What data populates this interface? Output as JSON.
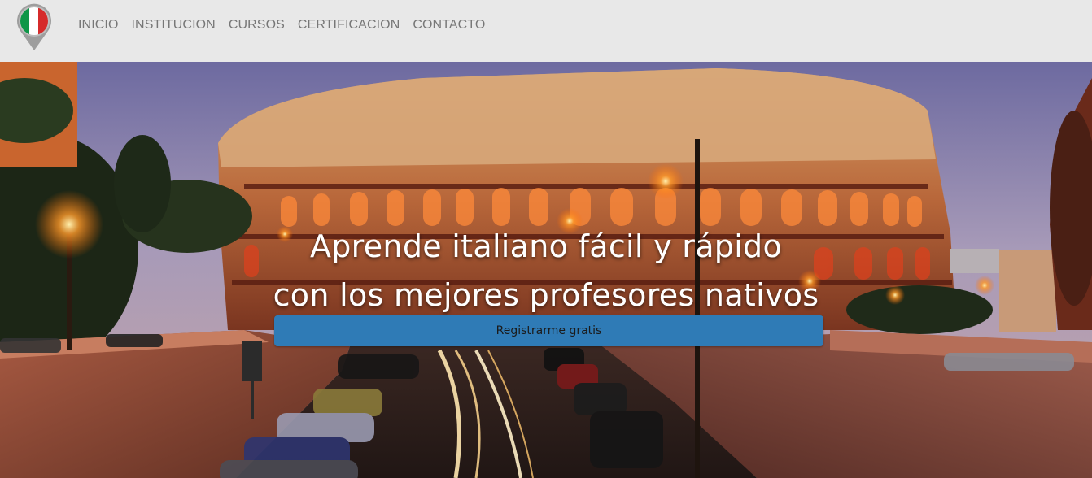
{
  "nav": {
    "items": [
      {
        "label": "INICIO"
      },
      {
        "label": "INSTITUCION"
      },
      {
        "label": "CURSOS"
      },
      {
        "label": "CERTIFICACION"
      },
      {
        "label": "CONTACTO"
      }
    ]
  },
  "logo": {
    "icon": "italy-flag-pin-icon",
    "colors": {
      "green": "#0f9648",
      "white": "#ffffff",
      "red": "#d62b2b",
      "pin": "#9e9e9e"
    }
  },
  "hero": {
    "headline_line1": "Aprende italiano fácil y rápido",
    "headline_line2": "con los mejores profesores nativos",
    "cta_label": "Registrarme gratis",
    "cta_color": "#2f7bb6"
  }
}
